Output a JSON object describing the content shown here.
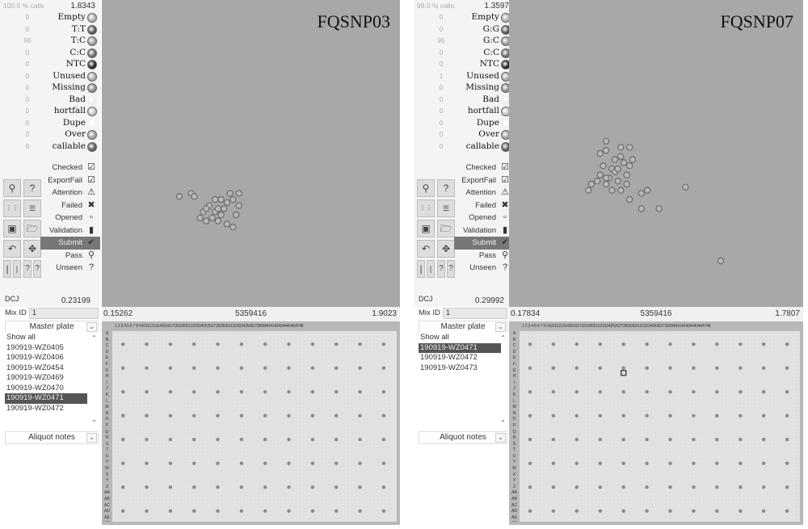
{
  "panels": [
    {
      "id": "left",
      "assay": "FQSNP03",
      "calls_pct": "100.0 % calls",
      "max_value": "1.8343",
      "call_categories": [
        {
          "count": "0",
          "label": "Empty",
          "color": "#b0b0b0"
        },
        {
          "count": "0",
          "label": "T:T",
          "color": "#555555"
        },
        {
          "count": "96",
          "label": "T:C",
          "color": "#9a9a9a"
        },
        {
          "count": "0",
          "label": "C:C",
          "color": "#6a6a6a"
        },
        {
          "count": "0",
          "label": "NTC",
          "color": "#222222"
        },
        {
          "count": "0",
          "label": "Unused",
          "color": "#a8a8a8"
        },
        {
          "count": "0",
          "label": "Missing",
          "color": "#8a8a8a"
        },
        {
          "count": "0",
          "label": "Bad",
          "color": "#eeeeee"
        },
        {
          "count": "0",
          "label": "hortfall",
          "color": "#c4c4c4"
        },
        {
          "count": "0",
          "label": "Dupe",
          "color": "#f8f8f8"
        },
        {
          "count": "0",
          "label": "Over",
          "color": "#a0a0a0"
        },
        {
          "count": "0",
          "label": "callable",
          "color": "#5a5a5a"
        }
      ],
      "status_filters": [
        {
          "label": "Checked",
          "icon": "checked-icon",
          "glyph": "☑",
          "selected": false
        },
        {
          "label": "ExportFail",
          "icon": "export-fail-icon",
          "glyph": "☑",
          "selected": false
        },
        {
          "label": "Attention",
          "icon": "attention-icon",
          "glyph": "⚠",
          "selected": false
        },
        {
          "label": "Failed",
          "icon": "failed-icon",
          "glyph": "✖",
          "selected": false
        },
        {
          "label": "Opened",
          "icon": "opened-icon",
          "glyph": "▫",
          "selected": false
        },
        {
          "label": "Validation",
          "icon": "validation-icon",
          "glyph": "▮",
          "selected": false
        },
        {
          "label": "Submit",
          "icon": "submit-icon",
          "glyph": "✔",
          "selected": true
        },
        {
          "label": "Pass",
          "icon": "pass-icon",
          "glyph": "⚲",
          "selected": false
        },
        {
          "label": "Unseen",
          "icon": "unseen-icon",
          "glyph": "?",
          "selected": false
        }
      ],
      "dcj_label": "DCJ",
      "dcj_value": "0.23199",
      "axis": {
        "min": "0.15262",
        "mid": "5359416",
        "max": "1.9023"
      },
      "mix_id_label": "Mix ID",
      "mix_id_value": "1",
      "plate_select": "Master plate",
      "plates": [
        "Show all",
        "190919-WZ0405",
        "190919-WZ0406",
        "190919-WZ0454",
        "190919-WZ0469",
        "190919-WZ0470",
        "190919-WZ0471",
        "190919-WZ0472"
      ],
      "selected_plate": "190919-WZ0471",
      "notes_select": "Aliquot notes",
      "scatter_points": [
        [
          0.26,
          0.64
        ],
        [
          0.3,
          0.63
        ],
        [
          0.31,
          0.64
        ],
        [
          0.38,
          0.69
        ],
        [
          0.37,
          0.71
        ],
        [
          0.4,
          0.7
        ],
        [
          0.42,
          0.66
        ],
        [
          0.44,
          0.65
        ],
        [
          0.46,
          0.67
        ],
        [
          0.42,
          0.73
        ],
        [
          0.44,
          0.74
        ],
        [
          0.39,
          0.68
        ],
        [
          0.35,
          0.72
        ],
        [
          0.36,
          0.67
        ],
        [
          0.33,
          0.71
        ],
        [
          0.38,
          0.65
        ],
        [
          0.45,
          0.7
        ],
        [
          0.46,
          0.63
        ],
        [
          0.43,
          0.63
        ],
        [
          0.41,
          0.68
        ],
        [
          0.39,
          0.72
        ],
        [
          0.34,
          0.69
        ],
        [
          0.35,
          0.68
        ],
        [
          0.4,
          0.65
        ]
      ],
      "highlight_well": null
    },
    {
      "id": "right",
      "assay": "FQSNP07",
      "calls_pct": "99.0 % calls",
      "max_value": "1.3597",
      "call_categories": [
        {
          "count": "0",
          "label": "Empty",
          "color": "#b0b0b0"
        },
        {
          "count": "0",
          "label": "G:G",
          "color": "#555555"
        },
        {
          "count": "95",
          "label": "G:C",
          "color": "#9a9a9a"
        },
        {
          "count": "0",
          "label": "C:C",
          "color": "#6a6a6a"
        },
        {
          "count": "0",
          "label": "NTC",
          "color": "#222222"
        },
        {
          "count": "1",
          "label": "Unused",
          "color": "#a8a8a8"
        },
        {
          "count": "0",
          "label": "Missing",
          "color": "#8a8a8a"
        },
        {
          "count": "0",
          "label": "Bad",
          "color": "#eeeeee"
        },
        {
          "count": "0",
          "label": "hortfall",
          "color": "#c4c4c4"
        },
        {
          "count": "0",
          "label": "Dupe",
          "color": "#f8f8f8"
        },
        {
          "count": "0",
          "label": "Over",
          "color": "#a0a0a0"
        },
        {
          "count": "0",
          "label": "callable",
          "color": "#5a5a5a"
        }
      ],
      "status_filters": [
        {
          "label": "Checked",
          "icon": "checked-icon",
          "glyph": "☑",
          "selected": false
        },
        {
          "label": "ExportFail",
          "icon": "export-fail-icon",
          "glyph": "☑",
          "selected": false
        },
        {
          "label": "Attention",
          "icon": "attention-icon",
          "glyph": "⚠",
          "selected": false
        },
        {
          "label": "Failed",
          "icon": "failed-icon",
          "glyph": "✖",
          "selected": false
        },
        {
          "label": "Opened",
          "icon": "opened-icon",
          "glyph": "▫",
          "selected": false
        },
        {
          "label": "Validation",
          "icon": "validation-icon",
          "glyph": "▮",
          "selected": false
        },
        {
          "label": "Submit",
          "icon": "submit-icon",
          "glyph": "✔",
          "selected": true
        },
        {
          "label": "Pass",
          "icon": "pass-icon",
          "glyph": "⚲",
          "selected": false
        },
        {
          "label": "Unseen",
          "icon": "unseen-icon",
          "glyph": "?",
          "selected": false
        }
      ],
      "dcj_label": "DCJ",
      "dcj_value": "0.29992",
      "axis": {
        "min": "0.17834",
        "mid": "5359416",
        "max": "1.7807"
      },
      "mix_id_label": "Mix ID",
      "mix_id_value": "1",
      "plate_select": "Master plate",
      "plates": [
        "Show all",
        "190919-WZ0471",
        "190919-WZ0472",
        "190919-WZ0473"
      ],
      "selected_plate": "190919-WZ0471",
      "notes_select": "Aliquot notes",
      "scatter_points": [
        [
          0.33,
          0.49
        ],
        [
          0.38,
          0.51
        ],
        [
          0.36,
          0.52
        ],
        [
          0.35,
          0.55
        ],
        [
          0.32,
          0.54
        ],
        [
          0.31,
          0.57
        ],
        [
          0.34,
          0.58
        ],
        [
          0.37,
          0.59
        ],
        [
          0.4,
          0.57
        ],
        [
          0.41,
          0.54
        ],
        [
          0.39,
          0.53
        ],
        [
          0.36,
          0.56
        ],
        [
          0.33,
          0.6
        ],
        [
          0.3,
          0.59
        ],
        [
          0.28,
          0.6
        ],
        [
          0.38,
          0.62
        ],
        [
          0.35,
          0.62
        ],
        [
          0.42,
          0.52
        ],
        [
          0.38,
          0.48
        ],
        [
          0.31,
          0.5
        ],
        [
          0.33,
          0.58
        ],
        [
          0.37,
          0.55
        ],
        [
          0.4,
          0.6
        ],
        [
          0.27,
          0.62
        ],
        [
          0.33,
          0.46
        ],
        [
          0.41,
          0.48
        ],
        [
          0.45,
          0.63
        ],
        [
          0.47,
          0.62
        ],
        [
          0.41,
          0.65
        ],
        [
          0.45,
          0.68
        ],
        [
          0.51,
          0.68
        ],
        [
          0.6,
          0.61
        ],
        [
          0.72,
          0.85
        ]
      ],
      "highlight_well": [
        4,
        1
      ]
    }
  ]
}
